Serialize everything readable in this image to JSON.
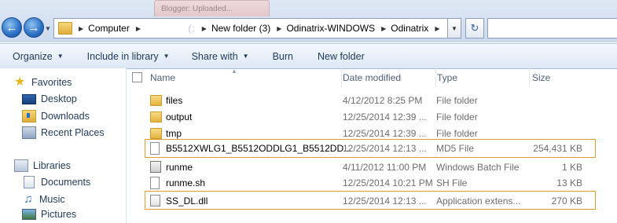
{
  "address_bar": {
    "crumbs": [
      {
        "label": "Computer"
      },
      {
        "label": "                (;"
      },
      {
        "label": "New folder (3)"
      },
      {
        "label": "Odinatrix-WINDOWS"
      },
      {
        "label": "Odinatrix"
      }
    ],
    "ghost_tab": "Blogger: Uploaded..."
  },
  "toolbar": {
    "organize": "Organize",
    "include_in_library": "Include in library",
    "share_with": "Share with",
    "burn": "Burn",
    "new_folder": "New folder"
  },
  "nav": {
    "favorites": "Favorites",
    "desktop": "Desktop",
    "downloads": "Downloads",
    "recent_places": "Recent Places",
    "libraries": "Libraries",
    "documents": "Documents",
    "music": "Music",
    "pictures": "Pictures"
  },
  "columns": {
    "name": "Name",
    "date_modified": "Date modified",
    "type": "Type",
    "size": "Size"
  },
  "files": [
    {
      "name": "files",
      "date": "4/12/2012 8:25 PM",
      "type": "File folder",
      "size": "",
      "icon": "folder-icon"
    },
    {
      "name": "output",
      "date": "12/25/2014 12:39 ...",
      "type": "File folder",
      "size": "",
      "icon": "folder-icon"
    },
    {
      "name": "tmp",
      "date": "12/25/2014 12:39 ...",
      "type": "File folder",
      "size": "",
      "icon": "folder-icon"
    },
    {
      "name": "B5512XWLG1_B5512ODDLG1_B5512DD...",
      "date": "12/25/2014 12:13 ...",
      "type": "MD5 File",
      "size": "254,431 KB",
      "icon": "file-icon"
    },
    {
      "name": "runme",
      "date": "4/11/2012 11:00 PM",
      "type": "Windows Batch File",
      "size": "1 KB",
      "icon": "batch-file-icon"
    },
    {
      "name": "runme.sh",
      "date": "12/25/2014 10:21 PM",
      "type": "SH File",
      "size": "13 KB",
      "icon": "file-icon"
    },
    {
      "name": "SS_DL.dll",
      "date": "12/25/2014 12:13 ...",
      "type": "Application extens...",
      "size": "270 KB",
      "icon": "dll-file-icon"
    }
  ],
  "highlight_color": "#e39a2f"
}
